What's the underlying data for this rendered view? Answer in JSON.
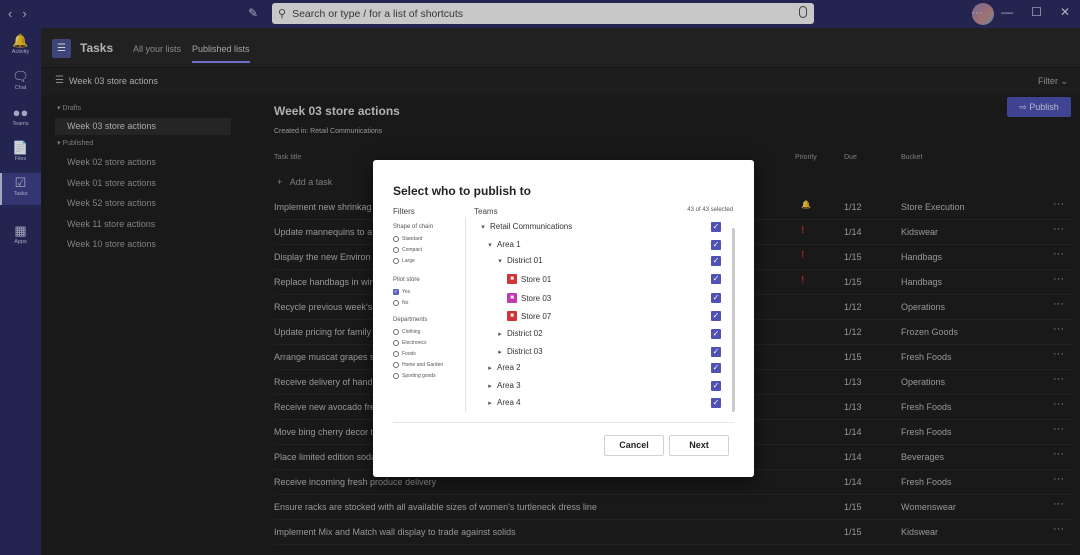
{
  "topbar": {
    "search_placeholder": "Search or type / for a list of shortcuts",
    "window_controls": [
      "···",
      "—",
      "☐",
      "✕"
    ]
  },
  "rail": {
    "items": [
      {
        "label": "Activity",
        "icon": "bell-icon"
      },
      {
        "label": "Chat",
        "icon": "chat-icon"
      },
      {
        "label": "Teams",
        "icon": "teams-icon"
      },
      {
        "label": "Files",
        "icon": "files-icon"
      },
      {
        "label": "Tasks",
        "icon": "tasks-icon",
        "active": true
      },
      {
        "label": "Apps",
        "icon": "apps-icon"
      }
    ]
  },
  "app": {
    "title": "Tasks",
    "tabs": [
      "All your lists",
      "Published lists"
    ],
    "active_tab": "Published lists"
  },
  "subbar": {
    "plan_title": "Week 03 store actions",
    "filter_label": "Filter"
  },
  "sidelist": {
    "drafts_label": "Drafts",
    "drafts": [
      "Week 03 store actions"
    ],
    "published_label": "Published",
    "published": [
      "Week 02 store actions",
      "Week 01 store actions",
      "Week 52 store actions",
      "Week 11 store actions",
      "Week 10 store actions"
    ]
  },
  "main": {
    "title": "Week 03 store actions",
    "created": "Created in: Retail Communications",
    "publish_label": "Publish",
    "columns": {
      "task": "Task title",
      "priority": "Priority",
      "due": "Due",
      "bucket": "Bucket"
    },
    "add_task": "Add a task",
    "rows": [
      {
        "title": "Implement new shrinkag",
        "due": "1/12",
        "bucket": "Store Execution",
        "priority": "urgent"
      },
      {
        "title": "Update mannequins to a",
        "due": "1/14",
        "bucket": "Kidswear",
        "priority": "important"
      },
      {
        "title": "Display the new Environ",
        "due": "1/15",
        "bucket": "Handbags",
        "priority": "important"
      },
      {
        "title": "Replace handbags in win",
        "due": "1/15",
        "bucket": "Handbags",
        "priority": "important"
      },
      {
        "title": "Recycle previous week's",
        "due": "1/12",
        "bucket": "Operations",
        "priority": ""
      },
      {
        "title": "Update pricing for family",
        "due": "1/12",
        "bucket": "Frozen Goods",
        "priority": ""
      },
      {
        "title": "Arrange muscat grapes s",
        "due": "1/15",
        "bucket": "Fresh Foods",
        "priority": ""
      },
      {
        "title": "Receive delivery of hand",
        "due": "1/13",
        "bucket": "Operations",
        "priority": ""
      },
      {
        "title": "Receive new avocado fre",
        "due": "1/13",
        "bucket": "Fresh Foods",
        "priority": ""
      },
      {
        "title": "Move bing cherry decor t",
        "due": "1/14",
        "bucket": "Fresh Foods",
        "priority": ""
      },
      {
        "title": "Place limited edition soda",
        "due": "1/14",
        "bucket": "Beverages",
        "priority": ""
      },
      {
        "title": "Receive incoming fresh produce delivery",
        "due": "1/14",
        "bucket": "Fresh Foods",
        "priority": ""
      },
      {
        "title": "Ensure racks are stocked with all available sizes of women's turtleneck dress line",
        "due": "1/15",
        "bucket": "Womenswear",
        "priority": ""
      },
      {
        "title": "Implement Mix and Match wall display to trade against solids",
        "due": "1/15",
        "bucket": "Kidswear",
        "priority": ""
      }
    ]
  },
  "dialog": {
    "title": "Select who to publish to",
    "filters_heading": "Filters",
    "teams_heading": "Teams",
    "selected_count": "43 of 43 selected",
    "filter_groups": [
      {
        "label": "Shape of chain",
        "type": "radio",
        "options": [
          "Standard",
          "Compact",
          "Large"
        ]
      },
      {
        "label": "Pilot store",
        "type": "checkbox",
        "options": [
          "Yes",
          "No"
        ]
      },
      {
        "label": "Departments",
        "type": "radio",
        "options": [
          "Clothing",
          "Electronics",
          "Foods",
          "Home and Garden",
          "Sporting goods"
        ]
      }
    ],
    "tree": [
      {
        "label": "Retail Communications",
        "level": 0,
        "expanded": true
      },
      {
        "label": "Area 1",
        "level": 1,
        "expanded": true
      },
      {
        "label": "District 01",
        "level": 2,
        "expanded": true
      },
      {
        "label": "Store 01",
        "level": 3,
        "store": true,
        "color": "#d13438"
      },
      {
        "label": "Store 03",
        "level": 3,
        "store": true,
        "color": "#c239b3"
      },
      {
        "label": "Store 07",
        "level": 3,
        "store": true,
        "color": "#d13438"
      },
      {
        "label": "District 02",
        "level": 2,
        "expanded": false
      },
      {
        "label": "District 03",
        "level": 2,
        "expanded": false
      },
      {
        "label": "Area 2",
        "level": 1,
        "expanded": false
      },
      {
        "label": "Area 3",
        "level": 1,
        "expanded": false
      },
      {
        "label": "Area 4",
        "level": 1,
        "expanded": false
      }
    ],
    "cancel_label": "Cancel",
    "next_label": "Next"
  },
  "colors": {
    "rail": "#2b2d62",
    "accent": "#4f52b2",
    "priority_urgent": "#c62828"
  }
}
